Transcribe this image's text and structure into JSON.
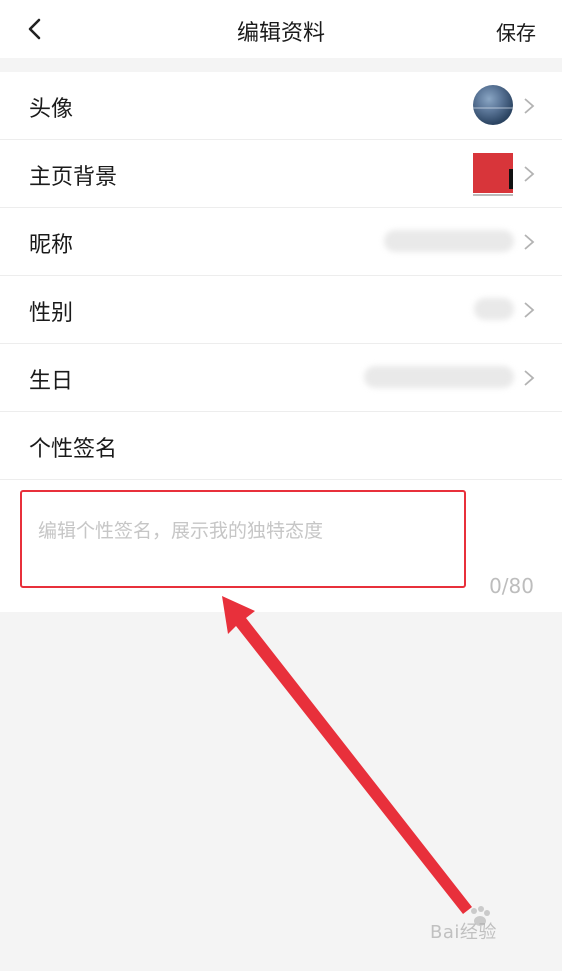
{
  "header": {
    "title": "编辑资料",
    "save_label": "保存",
    "back_icon": "chevron-left-icon"
  },
  "rows": [
    {
      "label": "头像",
      "value_type": "avatar"
    },
    {
      "label": "主页背景",
      "value_type": "background-thumbnail"
    },
    {
      "label": "昵称",
      "value_type": "blurred-text"
    },
    {
      "label": "性别",
      "value_type": "blurred-text"
    },
    {
      "label": "生日",
      "value_type": "blurred-text"
    }
  ],
  "signature": {
    "label": "个性签名",
    "placeholder": "编辑个性签名，展示我的独特态度",
    "value": "",
    "counter": "0/80"
  },
  "annotation": {
    "color": "#e8303b"
  },
  "watermark": {
    "text": "Bai经验"
  },
  "colors": {
    "accent": "#e8303b",
    "background": "#f4f4f4",
    "surface": "#ffffff"
  }
}
